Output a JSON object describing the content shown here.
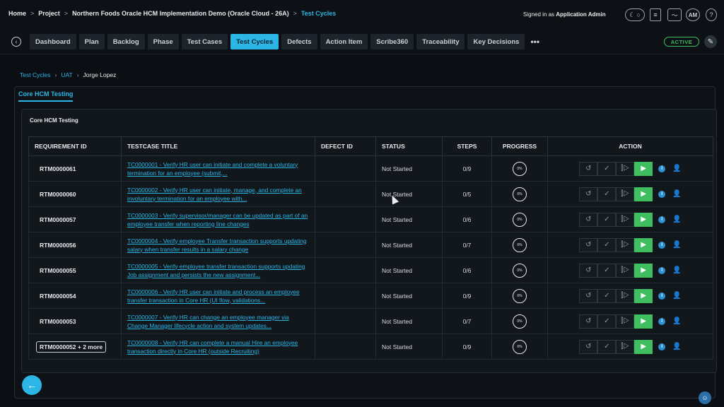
{
  "header": {
    "crumbs": [
      "Home",
      "Project",
      "Northern Foods Oracle HCM Implementation Demo (Oracle Cloud - 26A)",
      "Test Cycles"
    ],
    "separator": ">",
    "signed_in_prefix": "Signed in as",
    "signed_in_user": "Application Admin",
    "avatar_initials": "AM"
  },
  "tabs": [
    "Dashboard",
    "Plan",
    "Backlog",
    "Phase",
    "Test Cases",
    "Test Cycles",
    "Defects",
    "Action Item",
    "Scribe360",
    "Traceability",
    "Key Decisions"
  ],
  "active_tab": "Test Cycles",
  "more_label": "•••",
  "status_badge": "ACTIVE",
  "breadcrumb": [
    "Test Cycles",
    "UAT",
    "Jorge Lopez"
  ],
  "suite_tab": "Core HCM Testing",
  "panel_title": "Core HCM Testing",
  "table": {
    "headers": [
      "REQUIREMENT ID",
      "TESTCASE TITLE",
      "DEFECT ID",
      "STATUS",
      "STEPS",
      "PROGRESS",
      "ACTION"
    ],
    "rows": [
      {
        "rid": "RTM0000061",
        "title": "TC0000001 - Verify HR user can initiate and complete a voluntary termination for an employee (submit,...",
        "defect": "",
        "status": "Not Started",
        "steps": "0/9",
        "progress": "0%"
      },
      {
        "rid": "RTM0000060",
        "title": "TC0000002 - Verify HR user can initiate, manage, and complete an involuntary termination for an employee with...",
        "defect": "",
        "status": "Not Started",
        "steps": "0/5",
        "progress": "0%"
      },
      {
        "rid": "RTM0000057",
        "title": "TC0000003 - Verify supervisor/manager can be updated as part of an employee transfer when reporting line changes",
        "defect": "",
        "status": "Not Started",
        "steps": "0/6",
        "progress": "0%"
      },
      {
        "rid": "RTM0000056",
        "title": "TC0000004 - Verify employee Transfer transaction supports updating salary when transfer results in a salary change",
        "defect": "",
        "status": "Not Started",
        "steps": "0/7",
        "progress": "0%"
      },
      {
        "rid": "RTM0000055",
        "title": "TC0000005 - Verify employee transfer transaction supports updating Job assignment and persists the new assignment...",
        "defect": "",
        "status": "Not Started",
        "steps": "0/6",
        "progress": "0%"
      },
      {
        "rid": "RTM0000054",
        "title": "TC0000006 - Verify HR user can initiate and process an employee transfer transaction in Core HR (UI flow, validations...",
        "defect": "",
        "status": "Not Started",
        "steps": "0/9",
        "progress": "0%"
      },
      {
        "rid": "RTM0000053",
        "title": "TC0000007 - Verify HR can change an employee manager via Change Manager lifecycle action and system updates...",
        "defect": "",
        "status": "Not Started",
        "steps": "0/7",
        "progress": "0%"
      },
      {
        "rid": "RTM0000052 + 2 more",
        "title": "TC0000008 - Verify HR can complete a manual Hire an employee transaction directly in Core HR (outside Recruiting)",
        "defect": "",
        "status": "Not Started",
        "steps": "0/9",
        "progress": "0%"
      }
    ]
  },
  "colors": {
    "accent": "#2bb6e6",
    "run_button": "#3fbf5f",
    "active_badge": "#3fbf5f",
    "background": "#0b0e12"
  }
}
